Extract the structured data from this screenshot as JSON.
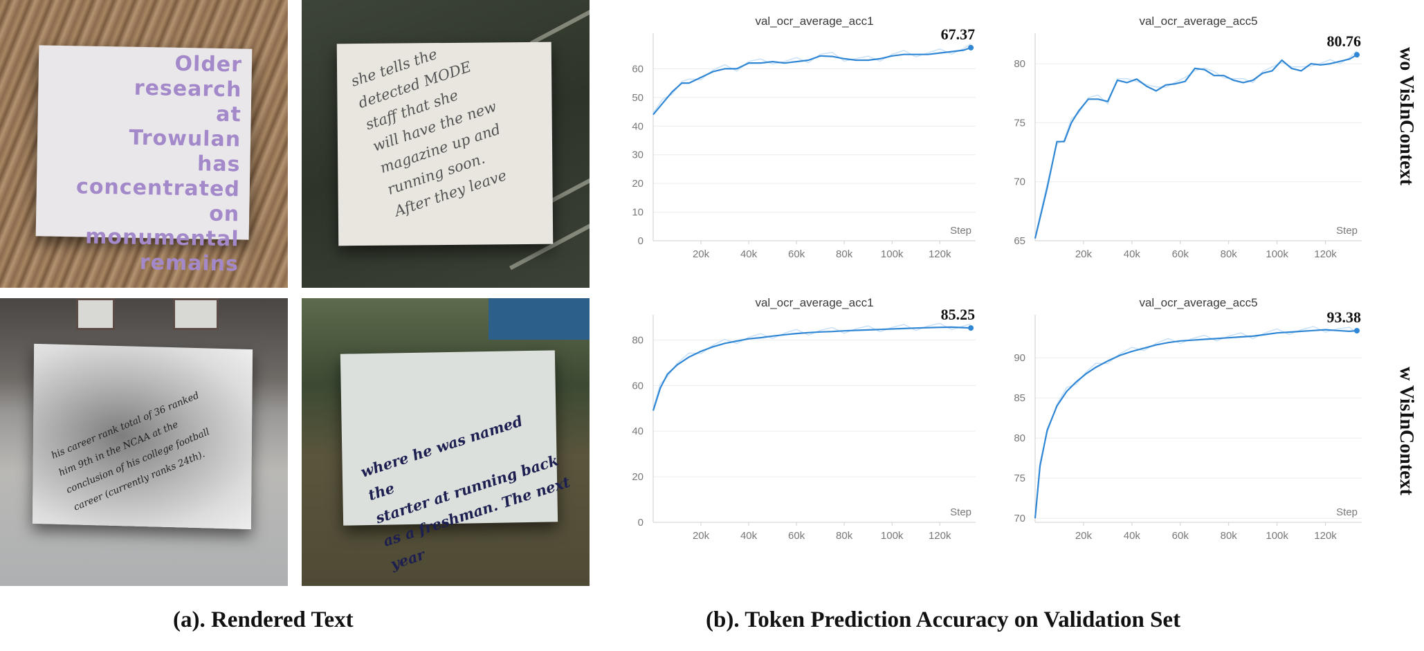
{
  "figure": {
    "caption_left": "(a). Rendered Text",
    "caption_right": "(b). Token Prediction Accuracy on Validation Set",
    "row_labels": [
      "wo VisInContext",
      "w VisInContext"
    ],
    "x_axis_label": "Step",
    "colors": {
      "line": "#2e86d4",
      "raw_line": "#c9e1f7",
      "paper_text_1": "#a389c9",
      "paper_text_4": "#1c1f4f"
    }
  },
  "samples": [
    {
      "text": "Older\nresearch\nat\nTrowulan\nhas\nconcentrated\non\nmonumental\nremains"
    },
    {
      "text": "she tells the\ndetected MODE\nstaff that she\nwill have the new\nmagazine up and\nrunning soon.\nAfter they leave"
    },
    {
      "text": "his career rank total of 36 ranked\nhim 9th in the NCAA at the\nconclusion of his college football\ncareer (currently ranks 24th)."
    },
    {
      "text": "where he was named the\nstarter at running back\nas a freshman. The next\nyear"
    }
  ],
  "chart_data": [
    {
      "type": "line",
      "title": "val_ocr_average_acc1",
      "row": "wo VisInContext",
      "final_value": "67.37",
      "xlabel": "Step",
      "ylabel": "",
      "xlim": [
        0,
        135000
      ],
      "ylim": [
        0,
        70
      ],
      "xticks": [
        20000,
        40000,
        60000,
        80000,
        100000,
        120000
      ],
      "xtick_labels": [
        "20k",
        "40k",
        "60k",
        "80k",
        "100k",
        "120k"
      ],
      "yticks": [
        0,
        10,
        20,
        30,
        40,
        50,
        60
      ],
      "series": [
        {
          "x": [
            0,
            4000,
            8000,
            12000,
            15000,
            20000,
            25000,
            30000,
            35000,
            40000,
            45000,
            50000,
            55000,
            60000,
            65000,
            70000,
            75000,
            80000,
            85000,
            90000,
            95000,
            100000,
            105000,
            110000,
            115000,
            120000,
            125000,
            130000,
            133000
          ],
          "y": [
            44,
            48,
            52,
            55,
            55,
            57,
            59,
            60,
            60,
            62,
            62,
            62.5,
            62,
            62.5,
            63,
            64.5,
            64.3,
            63.5,
            63,
            63,
            63.5,
            64.5,
            65,
            65,
            65,
            65.5,
            66,
            66.5,
            67.37
          ]
        }
      ]
    },
    {
      "type": "line",
      "title": "val_ocr_average_acc5",
      "row": "wo VisInContext",
      "final_value": "80.76",
      "xlabel": "Step",
      "ylabel": "",
      "xlim": [
        0,
        135000
      ],
      "ylim": [
        65,
        82
      ],
      "xticks": [
        20000,
        40000,
        60000,
        80000,
        100000,
        120000
      ],
      "xtick_labels": [
        "20k",
        "40k",
        "60k",
        "80k",
        "100k",
        "120k"
      ],
      "yticks": [
        65,
        70,
        75,
        80
      ],
      "series": [
        {
          "x": [
            0,
            5000,
            9000,
            12000,
            15000,
            18000,
            22000,
            26000,
            30000,
            34000,
            38000,
            42000,
            46000,
            50000,
            54000,
            58000,
            62000,
            66000,
            70000,
            74000,
            78000,
            82000,
            86000,
            90000,
            94000,
            98000,
            102000,
            106000,
            110000,
            114000,
            118000,
            122000,
            126000,
            130000,
            133000
          ],
          "y": [
            65.2,
            69.5,
            73.4,
            73.4,
            75,
            76,
            77,
            77,
            76.8,
            78.6,
            78.4,
            78.7,
            78.1,
            77.7,
            78.2,
            78.3,
            78.5,
            79.6,
            79.5,
            79,
            79,
            78.6,
            78.4,
            78.6,
            79.2,
            79.4,
            80.3,
            79.6,
            79.4,
            80,
            79.9,
            80,
            80.2,
            80.4,
            80.76
          ]
        }
      ]
    },
    {
      "type": "line",
      "title": "val_ocr_average_acc1",
      "row": "w VisInContext",
      "final_value": "85.25",
      "xlabel": "Step",
      "ylabel": "",
      "xlim": [
        0,
        135000
      ],
      "ylim": [
        0,
        88
      ],
      "xticks": [
        20000,
        40000,
        60000,
        80000,
        100000,
        120000
      ],
      "xtick_labels": [
        "20k",
        "40k",
        "60k",
        "80k",
        "100k",
        "120k"
      ],
      "yticks": [
        0,
        20,
        40,
        60,
        80
      ],
      "series": [
        {
          "x": [
            0,
            3000,
            6000,
            10000,
            15000,
            20000,
            25000,
            30000,
            35000,
            40000,
            45000,
            50000,
            55000,
            60000,
            65000,
            70000,
            75000,
            80000,
            85000,
            90000,
            95000,
            100000,
            105000,
            110000,
            115000,
            120000,
            125000,
            130000,
            133000
          ],
          "y": [
            49,
            59,
            65,
            69,
            72.5,
            75,
            77,
            78.5,
            79.5,
            80.5,
            81,
            81.7,
            82.3,
            82.8,
            83.2,
            83.5,
            83.7,
            84,
            84.2,
            84.4,
            84.6,
            84.8,
            85,
            85.2,
            85.4,
            85.5,
            85.6,
            85.4,
            85.25
          ]
        }
      ]
    },
    {
      "type": "line",
      "title": "val_ocr_average_acc5",
      "row": "w VisInContext",
      "final_value": "93.38",
      "xlabel": "Step",
      "ylabel": "",
      "xlim": [
        0,
        135000
      ],
      "ylim": [
        69.5,
        94.5
      ],
      "xticks": [
        20000,
        40000,
        60000,
        80000,
        100000,
        120000
      ],
      "xtick_labels": [
        "20k",
        "40k",
        "60k",
        "80k",
        "100k",
        "120k"
      ],
      "yticks": [
        70,
        75,
        80,
        85,
        90
      ],
      "series": [
        {
          "x": [
            0,
            2000,
            5000,
            9000,
            13000,
            17000,
            21000,
            25000,
            30000,
            35000,
            40000,
            45000,
            50000,
            55000,
            60000,
            65000,
            70000,
            75000,
            80000,
            85000,
            90000,
            95000,
            100000,
            105000,
            110000,
            115000,
            120000,
            125000,
            130000,
            133000
          ],
          "y": [
            70,
            76.5,
            81,
            84,
            85.8,
            87,
            88,
            88.8,
            89.6,
            90.3,
            90.8,
            91.2,
            91.6,
            91.9,
            92.1,
            92.2,
            92.3,
            92.4,
            92.5,
            92.6,
            92.7,
            92.9,
            93.1,
            93.2,
            93.3,
            93.4,
            93.5,
            93.4,
            93.3,
            93.38
          ]
        }
      ]
    }
  ]
}
